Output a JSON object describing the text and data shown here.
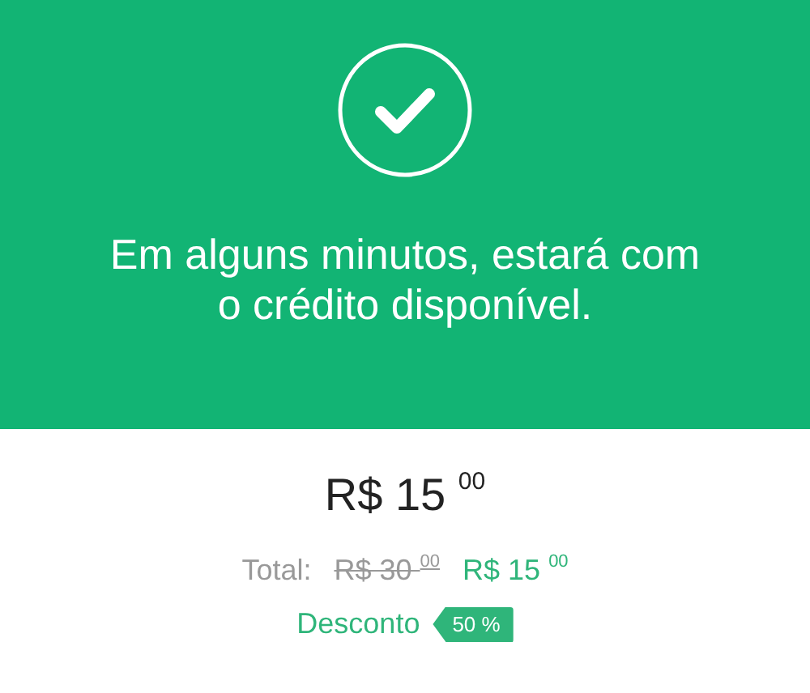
{
  "confirmation": {
    "message": "Em alguns minutos, estará com o crédito disponível."
  },
  "price": "R$ 15 $^{00}$",
  "total": {
    "label": "Total:",
    "original": "R$ 30 $^{00}$",
    "final": "R$ 15 $^{00}$"
  },
  "discount": {
    "label": "Desconto",
    "badge": "50 %"
  }
}
